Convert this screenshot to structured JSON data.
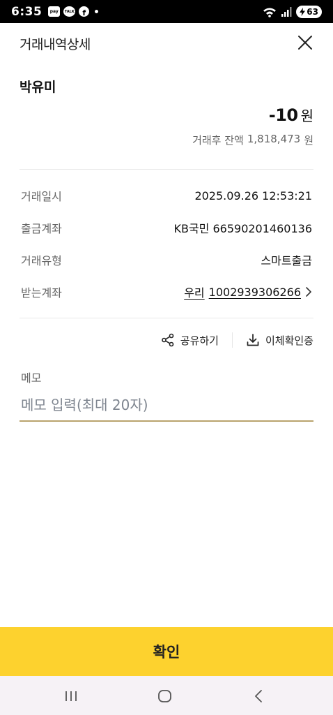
{
  "status_bar": {
    "time": "6:35",
    "app_icons": [
      "pay",
      "TALK"
    ],
    "battery": "63"
  },
  "header": {
    "title": "거래내역상세"
  },
  "transaction": {
    "payee": "박유미",
    "amount": "-10",
    "amount_unit": "원",
    "balance_label": "거래후 잔액",
    "balance_value": "1,818,473",
    "balance_unit": "원"
  },
  "details": [
    {
      "label": "거래일시",
      "value": "2025.09.26 12:53:21"
    },
    {
      "label": "출금계좌",
      "value": "KB국민 66590201460136"
    },
    {
      "label": "거래유형",
      "value": "스마트출금"
    },
    {
      "label": "받는계좌",
      "bank": "우리",
      "account": "1002939306266"
    }
  ],
  "actions": {
    "share_label": "공유하기",
    "certificate_label": "이체확인증"
  },
  "memo": {
    "label": "메모",
    "placeholder": "메모 입력(최대 20자)"
  },
  "confirm_label": "확인",
  "icons": {
    "close": "close-icon",
    "share": "share-icon",
    "download": "download-icon",
    "chevron": "chevron-right-icon"
  },
  "colors": {
    "accent_yellow": "#fdd22e",
    "memo_underline": "#b9a36d"
  }
}
